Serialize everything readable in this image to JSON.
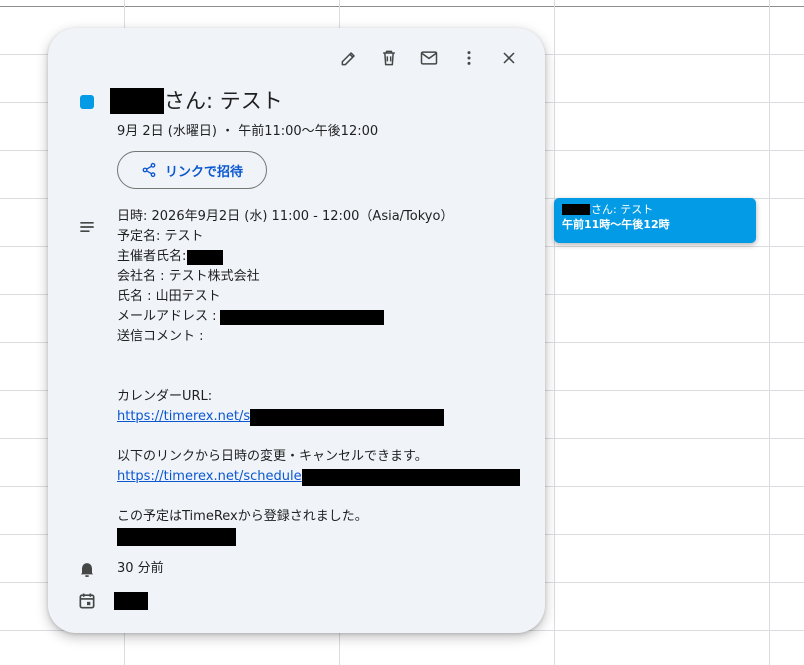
{
  "event": {
    "title_suffix": "さん: テスト",
    "datetime": "9月 2日 (水曜日) ・ 午前11:00～午後12:00",
    "color": "#039be5"
  },
  "toolbar": {
    "edit_icon": "pencil-icon",
    "delete_icon": "trash-icon",
    "email_icon": "mail-icon",
    "more_icon": "more-vert-icon",
    "close_icon": "close-icon"
  },
  "invite_button": {
    "label": "リンクで招待",
    "icon": "share-icon"
  },
  "description": {
    "line_datetime": "日時: 2026年9月2日 (水) 11:00 - 12:00（Asia/Tokyo）",
    "line_schedule_name": "予定名: テスト",
    "line_host_label": "主催者氏名:",
    "line_company": "会社名 : テスト株式会社",
    "line_name": "氏名 : 山田テスト",
    "line_email_label": "メールアドレス :",
    "line_comment_label": "送信コメント :",
    "line_calendar_url_label": "カレンダーURL:",
    "calendar_url_visible": "https://timerex.net/s",
    "line_change_note": "以下のリンクから日時の変更・キャンセルできます。",
    "schedule_url_visible": "https://timerex.net/schedule",
    "line_registered": "この予定はTimeRexから登録されました。"
  },
  "reminder": {
    "text": "30 分前",
    "icon": "bell-icon"
  },
  "calendar": {
    "icon": "calendar-icon"
  },
  "grid_event_chip": {
    "title_suffix": "さん: テスト",
    "time": "午前11時～午後12時"
  }
}
